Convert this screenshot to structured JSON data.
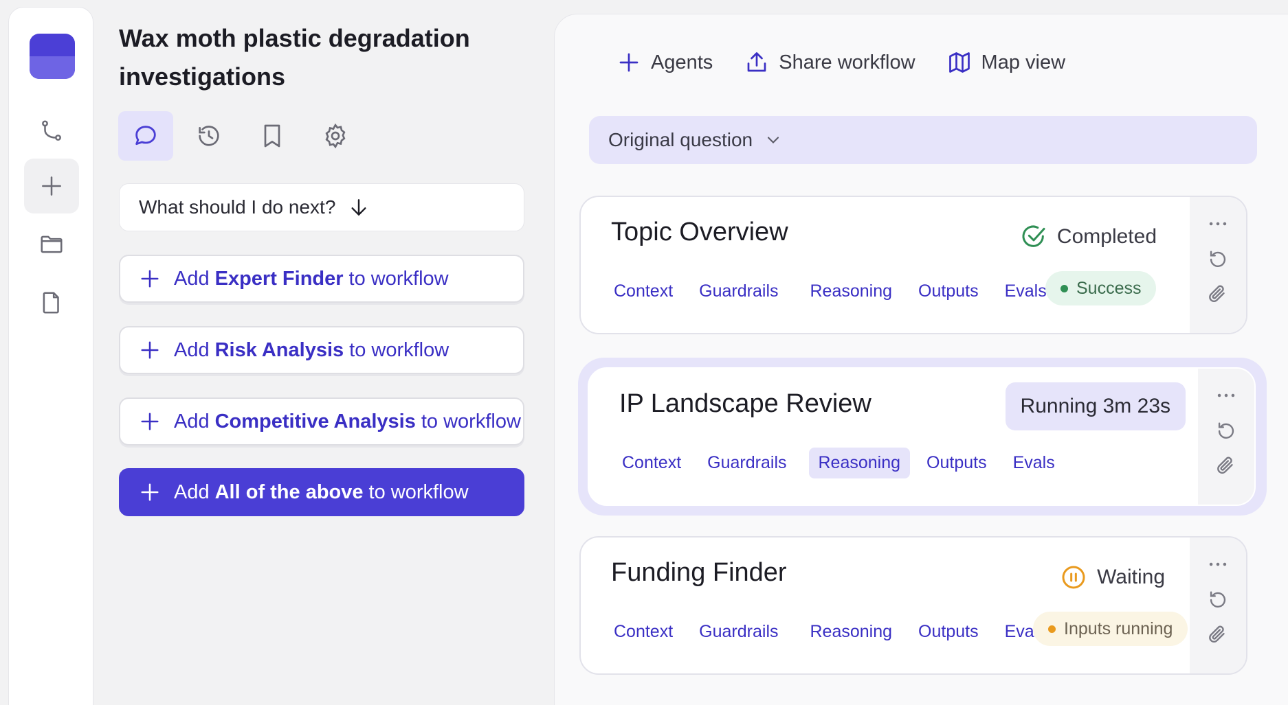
{
  "workflow": {
    "title": "Wax moth plastic degradation investigations",
    "next_prompt": "What should I do next?",
    "suggestions": [
      {
        "prefix": "Add",
        "bold": "Expert Finder",
        "suffix": "to workflow",
        "primary": false
      },
      {
        "prefix": "Add",
        "bold": "Risk Analysis",
        "suffix": "to workflow",
        "primary": false
      },
      {
        "prefix": "Add",
        "bold": "Competitive Analysis",
        "suffix": "to workflow",
        "primary": false
      },
      {
        "prefix": "Add",
        "bold": "All of the above",
        "suffix": "to workflow",
        "primary": true
      }
    ]
  },
  "rail": {
    "icons": [
      "branch-icon",
      "plus-icon",
      "folder-icon",
      "file-icon"
    ]
  },
  "panel_tabs": [
    "chat-icon",
    "history-icon",
    "bookmark-icon",
    "settings-icon"
  ],
  "toolbar": {
    "agents": "Agents",
    "share": "Share workflow",
    "map": "Map view"
  },
  "question": {
    "label": "Original question"
  },
  "cards": [
    {
      "title": "Topic Overview",
      "status": "Completed",
      "status_color": "#2f8f54",
      "links": [
        "Context",
        "Guardrails",
        "Reasoning",
        "Outputs",
        "Evals"
      ],
      "badge": "Success"
    },
    {
      "title": "IP Landscape Review",
      "status": "Running 3m 23s",
      "links": [
        "Context",
        "Guardrails",
        "Reasoning",
        "Outputs",
        "Evals"
      ],
      "active_link": "Reasoning"
    },
    {
      "title": "Funding Finder",
      "status": "Waiting",
      "status_color": "#e99a1e",
      "links": [
        "Context",
        "Guardrails",
        "Reasoning",
        "Outputs",
        "Evals"
      ],
      "badge": "Inputs running"
    }
  ],
  "colors": {
    "accent": "#4a3ed5",
    "accent_soft": "#e6e4fa",
    "link": "#3a2fc4"
  }
}
